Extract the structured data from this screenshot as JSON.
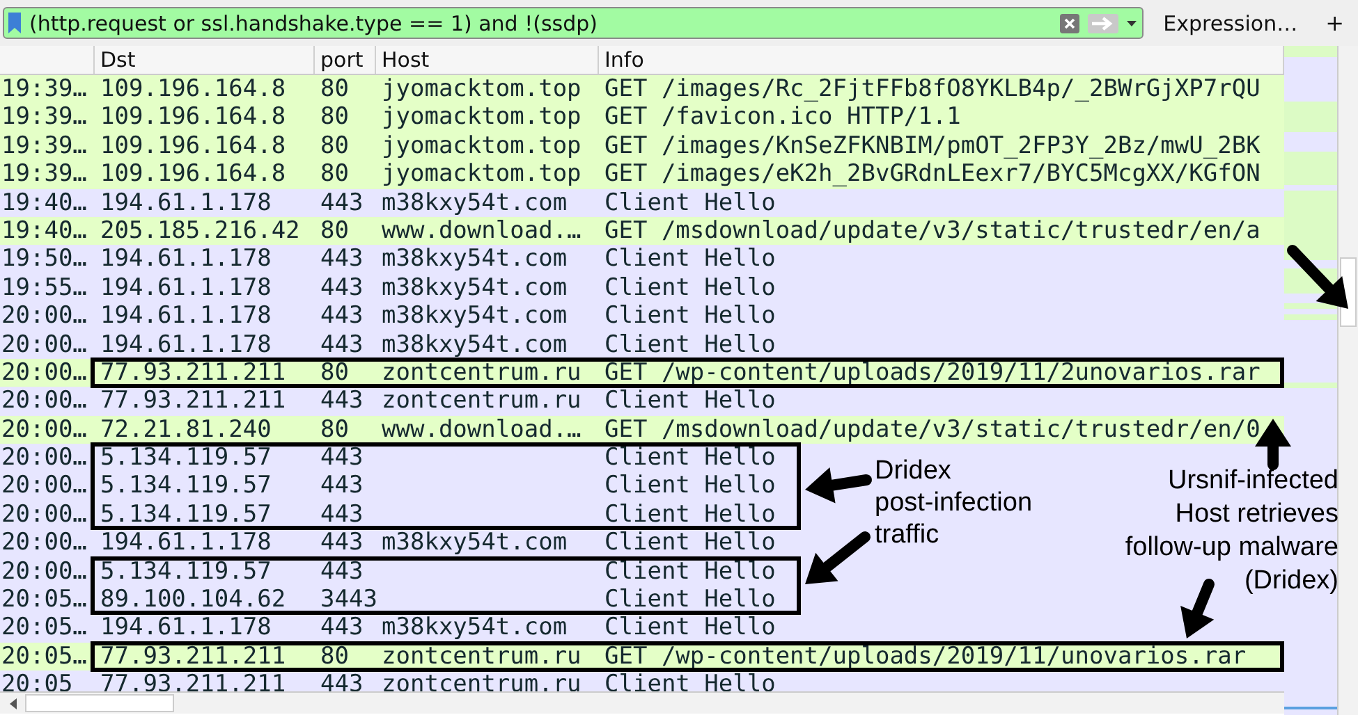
{
  "filter_bar": {
    "value": "(http.request or ssl.handshake.type == 1) and !(ssdp)",
    "expression_button": "Expression…",
    "add_button": "+"
  },
  "columns": [
    "Dst",
    "port",
    "Host",
    "Info"
  ],
  "rows": [
    {
      "time": "19:39…",
      "dst": "109.196.164.8",
      "port": "80",
      "host": "jyomacktom.top",
      "info": "GET /images/Rc_2FjtFFb8fO8YKLB4p/_2BWrGjXP7rQU",
      "kind": "http",
      "boxed": false
    },
    {
      "time": "19:39…",
      "dst": "109.196.164.8",
      "port": "80",
      "host": "jyomacktom.top",
      "info": "GET /favicon.ico HTTP/1.1",
      "kind": "http",
      "boxed": false
    },
    {
      "time": "19:39…",
      "dst": "109.196.164.8",
      "port": "80",
      "host": "jyomacktom.top",
      "info": "GET /images/KnSeZFKNBIM/pmOT_2FP3Y_2Bz/mwU_2BK",
      "kind": "http",
      "boxed": false
    },
    {
      "time": "19:39…",
      "dst": "109.196.164.8",
      "port": "80",
      "host": "jyomacktom.top",
      "info": "GET /images/eK2h_2BvGRdnLEexr7/BYC5McgXX/KGfON",
      "kind": "http",
      "boxed": false
    },
    {
      "time": "19:40…",
      "dst": "194.61.1.178",
      "port": "443",
      "host": "m38kxy54t.com",
      "info": "Client Hello",
      "kind": "tls",
      "boxed": false
    },
    {
      "time": "19:40…",
      "dst": "205.185.216.42",
      "port": "80",
      "host": "www.download.…",
      "info": "GET /msdownload/update/v3/static/trustedr/en/a",
      "kind": "http",
      "boxed": false
    },
    {
      "time": "19:50…",
      "dst": "194.61.1.178",
      "port": "443",
      "host": "m38kxy54t.com",
      "info": "Client Hello",
      "kind": "tls",
      "boxed": false
    },
    {
      "time": "19:55…",
      "dst": "194.61.1.178",
      "port": "443",
      "host": "m38kxy54t.com",
      "info": "Client Hello",
      "kind": "tls",
      "boxed": false
    },
    {
      "time": "20:00…",
      "dst": "194.61.1.178",
      "port": "443",
      "host": "m38kxy54t.com",
      "info": "Client Hello",
      "kind": "tls",
      "boxed": false
    },
    {
      "time": "20:00…",
      "dst": "194.61.1.178",
      "port": "443",
      "host": "m38kxy54t.com",
      "info": "Client Hello",
      "kind": "tls",
      "boxed": false
    },
    {
      "time": "20:00…",
      "dst": "77.93.211.211",
      "port": "80",
      "host": "zontcentrum.ru",
      "info": "GET /wp-content/uploads/2019/11/2unovarios.rar",
      "kind": "http",
      "boxed": true
    },
    {
      "time": "20:00…",
      "dst": "77.93.211.211",
      "port": "443",
      "host": "zontcentrum.ru",
      "info": "Client Hello",
      "kind": "tls",
      "boxed": false
    },
    {
      "time": "20:00…",
      "dst": "72.21.81.240",
      "port": "80",
      "host": "www.download.…",
      "info": "GET /msdownload/update/v3/static/trustedr/en/0",
      "kind": "http",
      "boxed": false
    },
    {
      "time": "20:00…",
      "dst": "5.134.119.57",
      "port": "443",
      "info": "Client Hello",
      "kind": "tls",
      "boxed": true
    },
    {
      "time": "20:00…",
      "dst": "5.134.119.57",
      "port": "443",
      "info": "Client Hello",
      "kind": "tls",
      "boxed": true
    },
    {
      "time": "20:00…",
      "dst": "5.134.119.57",
      "port": "443",
      "info": "Client Hello",
      "kind": "tls",
      "boxed": true
    },
    {
      "time": "20:00…",
      "dst": "194.61.1.178",
      "port": "443",
      "host": "m38kxy54t.com",
      "info": "Client Hello",
      "kind": "tls",
      "boxed": false
    },
    {
      "time": "20:00…",
      "dst": "5.134.119.57",
      "port": "443",
      "info": "Client Hello",
      "kind": "tls",
      "boxed": true
    },
    {
      "time": "20:05…",
      "dst": "89.100.104.62",
      "port": "3443",
      "info": "Client Hello",
      "kind": "tls",
      "boxed": true
    },
    {
      "time": "20:05…",
      "dst": "194.61.1.178",
      "port": "443",
      "host": "m38kxy54t.com",
      "info": "Client Hello",
      "kind": "tls",
      "boxed": false
    },
    {
      "time": "20:05…",
      "dst": "77.93.211.211",
      "port": "80",
      "host": "zontcentrum.ru",
      "info": "GET /wp-content/uploads/2019/11/unovarios.rar",
      "kind": "http",
      "boxed": true
    },
    {
      "time": "20:05",
      "dst": "77.93.211.211",
      "port": "443",
      "host": "zontcentrum.ru",
      "info": "Client Hello",
      "kind": "tls",
      "boxed": false
    }
  ],
  "annotations": [
    {
      "kind": "left",
      "lines": [
        "Dridex",
        "post-infection",
        "traffic"
      ]
    },
    {
      "kind": "right",
      "lines": [
        "Ursnif-infected",
        "Host retrieves",
        "follow-up malware",
        "(Dridex)"
      ]
    }
  ]
}
